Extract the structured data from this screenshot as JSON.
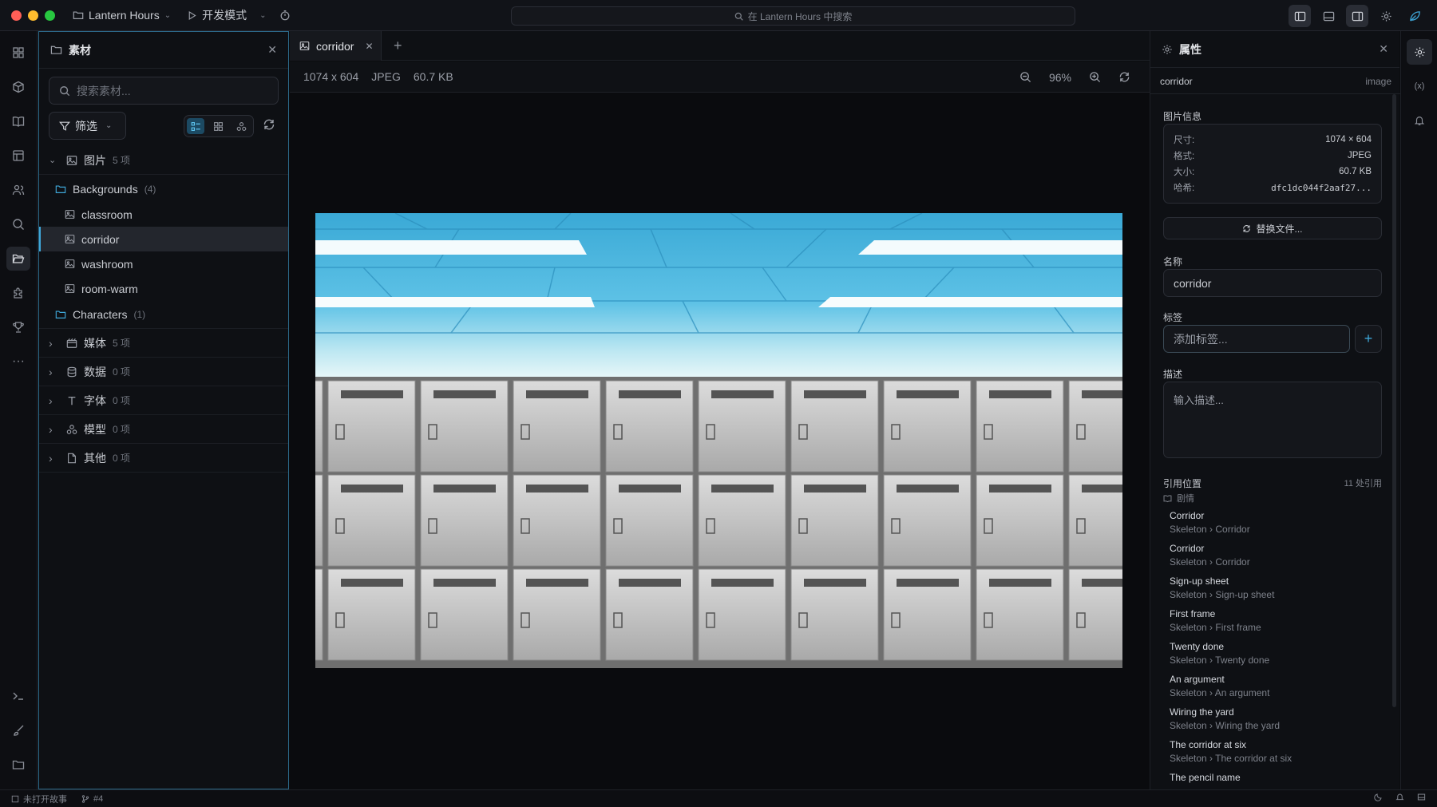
{
  "app": {
    "project": "Lantern Hours",
    "mode": "开发模式",
    "search_placeholder": "在 Lantern Hours 中搜索"
  },
  "assets_panel": {
    "title": "素材",
    "search_placeholder": "搜索素材...",
    "filter_label": "筛选",
    "categories": [
      {
        "label": "图片",
        "count": "5 项"
      },
      {
        "label": "媒体",
        "count": "5 项"
      },
      {
        "label": "数据",
        "count": "0 项"
      },
      {
        "label": "字体",
        "count": "0 项"
      },
      {
        "label": "模型",
        "count": "0 项"
      },
      {
        "label": "其他",
        "count": "0 项"
      }
    ],
    "folders": [
      {
        "label": "Backgrounds",
        "count": "(4)"
      },
      {
        "label": "Characters",
        "count": "(1)"
      }
    ],
    "backgrounds": [
      "classroom",
      "corridor",
      "washroom",
      "room-warm"
    ]
  },
  "editor": {
    "tab_label": "corridor",
    "dimensions": "1074 x 604",
    "format": "JPEG",
    "size": "60.7 KB",
    "zoom": "96%"
  },
  "properties": {
    "title": "属性",
    "asset_name": "corridor",
    "asset_type": "image",
    "info_section": "图片信息",
    "info": [
      {
        "k": "尺寸:",
        "v": "1074 × 604"
      },
      {
        "k": "格式:",
        "v": "JPEG"
      },
      {
        "k": "大小:",
        "v": "60.7 KB"
      },
      {
        "k": "哈希:",
        "v": "dfc1dc044f2aaf27..."
      }
    ],
    "replace_button": "替换文件...",
    "name_label": "名称",
    "name_value": "corridor",
    "tags_label": "标签",
    "tags_placeholder": "添加标签...",
    "desc_label": "描述",
    "desc_placeholder": "输入描述...",
    "refs_label": "引用位置",
    "refs_count": "11 处引用",
    "refs_group": "剧情",
    "refs": [
      {
        "t": "Corridor",
        "s": "Skeleton › Corridor"
      },
      {
        "t": "Corridor",
        "s": "Skeleton › Corridor"
      },
      {
        "t": "Sign-up sheet",
        "s": "Skeleton › Sign-up sheet"
      },
      {
        "t": "First frame",
        "s": "Skeleton › First frame"
      },
      {
        "t": "Twenty done",
        "s": "Skeleton › Twenty done"
      },
      {
        "t": "An argument",
        "s": "Skeleton › An argument"
      },
      {
        "t": "Wiring the yard",
        "s": "Skeleton › Wiring the yard"
      },
      {
        "t": "The corridor at six",
        "s": "Skeleton › The corridor at six"
      },
      {
        "t": "The pencil name",
        "s": ""
      }
    ]
  },
  "status": {
    "story": "未打开故事",
    "branch": "#4"
  }
}
